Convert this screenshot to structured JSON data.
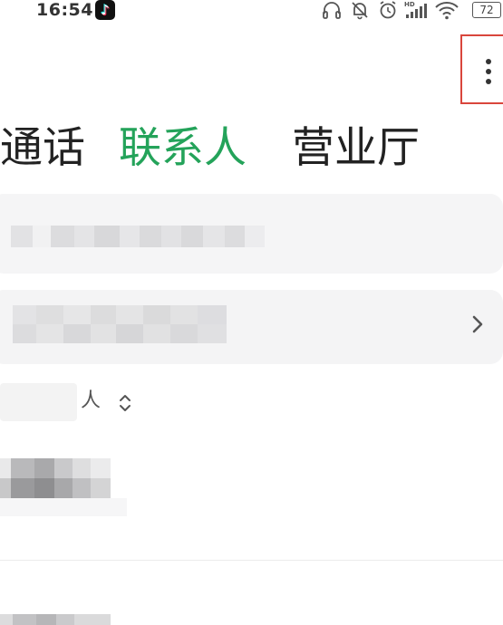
{
  "status_bar": {
    "time": "16:54",
    "app_icon": "tiktok-icon",
    "icons": [
      "headphones-icon",
      "mute-icon",
      "alarm-icon",
      "signal-hd-icon",
      "wifi-icon",
      "battery-icon"
    ],
    "battery_level": "72"
  },
  "header": {
    "more_icon": "more-vertical-icon"
  },
  "tabs": [
    {
      "label": "通话",
      "active": false
    },
    {
      "label": "联系人",
      "active": true
    },
    {
      "label": "营业厅",
      "active": false
    }
  ],
  "colors": {
    "accent": "#24a35a",
    "highlight_border": "#d9463c",
    "card_bg": "#f4f4f5"
  },
  "list": {
    "sort_suffix": "人"
  }
}
